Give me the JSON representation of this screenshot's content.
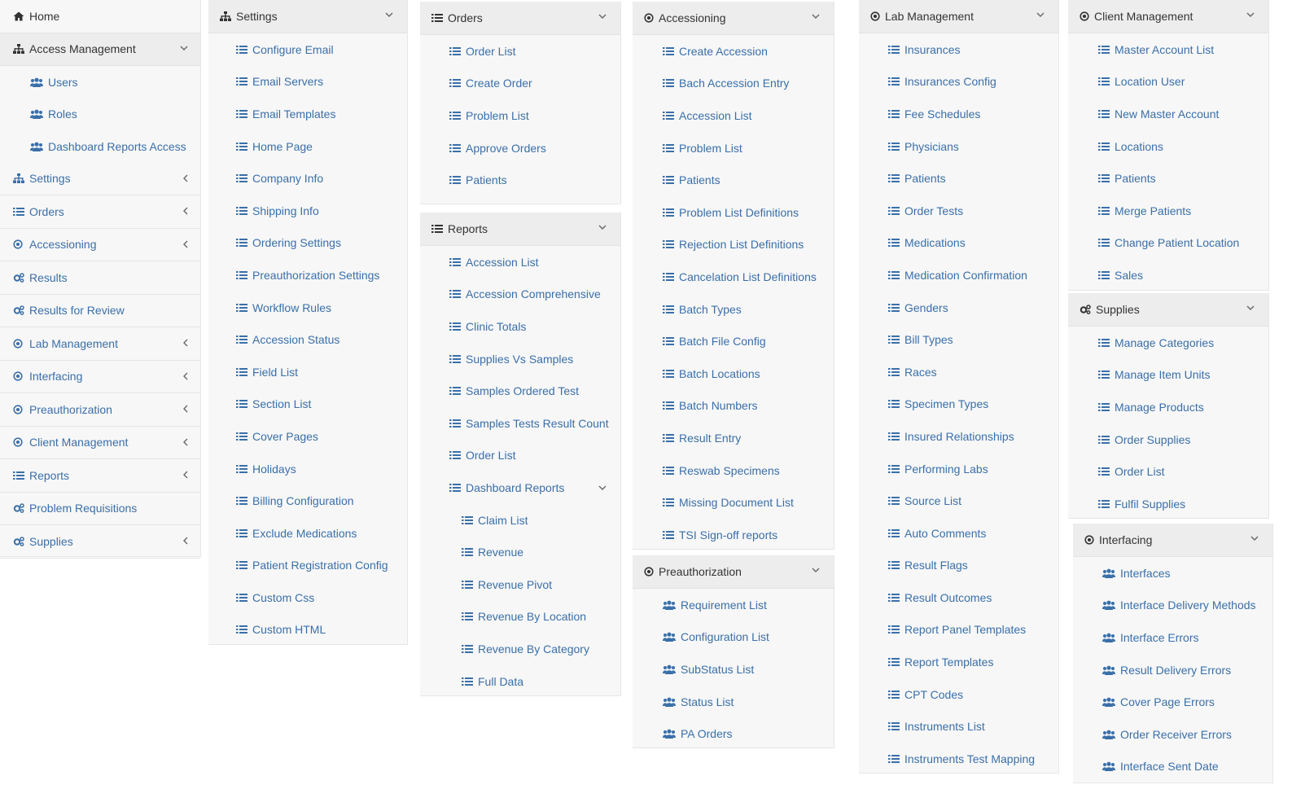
{
  "sidebar": {
    "items": [
      {
        "label": "Home",
        "icon": "home-icon"
      },
      {
        "label": "Access Management",
        "icon": "sitemap-icon",
        "open": true,
        "children": [
          {
            "label": "Users"
          },
          {
            "label": "Roles"
          },
          {
            "label": "Dashboard Reports Access"
          }
        ]
      },
      {
        "label": "Settings",
        "icon": "sitemap-icon"
      },
      {
        "label": "Orders",
        "icon": "list-icon"
      },
      {
        "label": "Accessioning",
        "icon": "dot-circle-icon"
      },
      {
        "label": "Results",
        "icon": "cogs-icon"
      },
      {
        "label": "Results for Review",
        "icon": "cogs-icon"
      },
      {
        "label": "Lab Management",
        "icon": "dot-circle-icon"
      },
      {
        "label": "Interfacing",
        "icon": "dot-circle-icon"
      },
      {
        "label": "Preauthorization",
        "icon": "dot-circle-icon"
      },
      {
        "label": "Client Management",
        "icon": "dot-circle-icon"
      },
      {
        "label": "Reports",
        "icon": "list-icon"
      },
      {
        "label": "Problem Requisitions",
        "icon": "cogs-icon"
      },
      {
        "label": "Supplies",
        "icon": "cogs-icon"
      }
    ]
  },
  "settings": {
    "title": "Settings",
    "items": [
      "Configure Email",
      "Email Servers",
      "Email Templates",
      "Home Page",
      "Company Info",
      "Shipping Info",
      "Ordering Settings",
      "Preauthorization Settings",
      "Workflow Rules",
      "Accession Status",
      "Field List",
      "Section List",
      "Cover Pages",
      "Holidays",
      "Billing Configuration",
      "Exclude Medications",
      "Patient Registration Config",
      "Custom Css",
      "Custom HTML"
    ]
  },
  "orders": {
    "title": "Orders",
    "items": [
      "Order List",
      "Create Order",
      "Problem List",
      "Approve Orders",
      "Patients"
    ]
  },
  "reports": {
    "title": "Reports",
    "items": [
      "Accession List",
      "Accession Comprehensive",
      "Clinic Totals",
      "Supplies Vs Samples",
      "Samples Ordered Test",
      "Samples Tests Result Count",
      "Order List"
    ],
    "dashboard_label": "Dashboard Reports",
    "dashboard_items": [
      "Claim List",
      "Revenue",
      "Revenue Pivot",
      "Revenue By Location",
      "Revenue By Category",
      "Full Data"
    ]
  },
  "accessioning": {
    "title": "Accessioning",
    "items": [
      "Create Accession",
      "Bach Accession Entry",
      "Accession List",
      "Problem List",
      "Patients",
      "Problem List Definitions",
      "Rejection List Definitions",
      "Cancelation List Definitions",
      "Batch Types",
      "Batch File Config",
      "Batch Locations",
      "Batch Numbers",
      "Result Entry",
      "Reswab Specimens",
      "Missing Document List",
      "TSI Sign-off reports"
    ]
  },
  "preauthorization": {
    "title": "Preauthorization",
    "items": [
      "Requirement List",
      "Configuration List",
      "SubStatus List",
      "Status List",
      "PA Orders"
    ]
  },
  "lab_management": {
    "title": "Lab Management",
    "items": [
      "Insurances",
      "Insurances Config",
      "Fee Schedules",
      "Physicians",
      "Patients",
      "Order Tests",
      "Medications",
      "Medication Confirmation",
      "Genders",
      "Bill Types",
      "Races",
      "Specimen Types",
      "Insured Relationships",
      "Performing Labs",
      "Source List",
      "Auto Comments",
      "Result Flags",
      "Result Outcomes",
      "Report Panel Templates",
      "Report Templates",
      "CPT Codes",
      "Instruments List",
      "Instruments Test Mapping"
    ]
  },
  "client_management": {
    "title": "Client Management",
    "items": [
      "Master Account List",
      "Location User",
      "New Master Account",
      "Locations",
      "Patients",
      "Merge Patients",
      "Change Patient Location",
      "Sales"
    ]
  },
  "supplies": {
    "title": "Supplies",
    "items": [
      "Manage Categories",
      "Manage Item Units",
      "Manage Products",
      "Order Supplies",
      "Order List",
      "Fulfil Supplies"
    ]
  },
  "interfacing": {
    "title": "Interfacing",
    "items": [
      "Interfaces",
      "Interface Delivery Methods",
      "Interface Errors",
      "Result Delivery Errors",
      "Cover Page Errors",
      "Order Receiver Errors",
      "Interface Sent Date"
    ]
  },
  "colors": {
    "link": "#3a6fa8",
    "header_text": "#333333",
    "panel_bg": "#f7f7f7",
    "header_bg": "#ededed"
  }
}
